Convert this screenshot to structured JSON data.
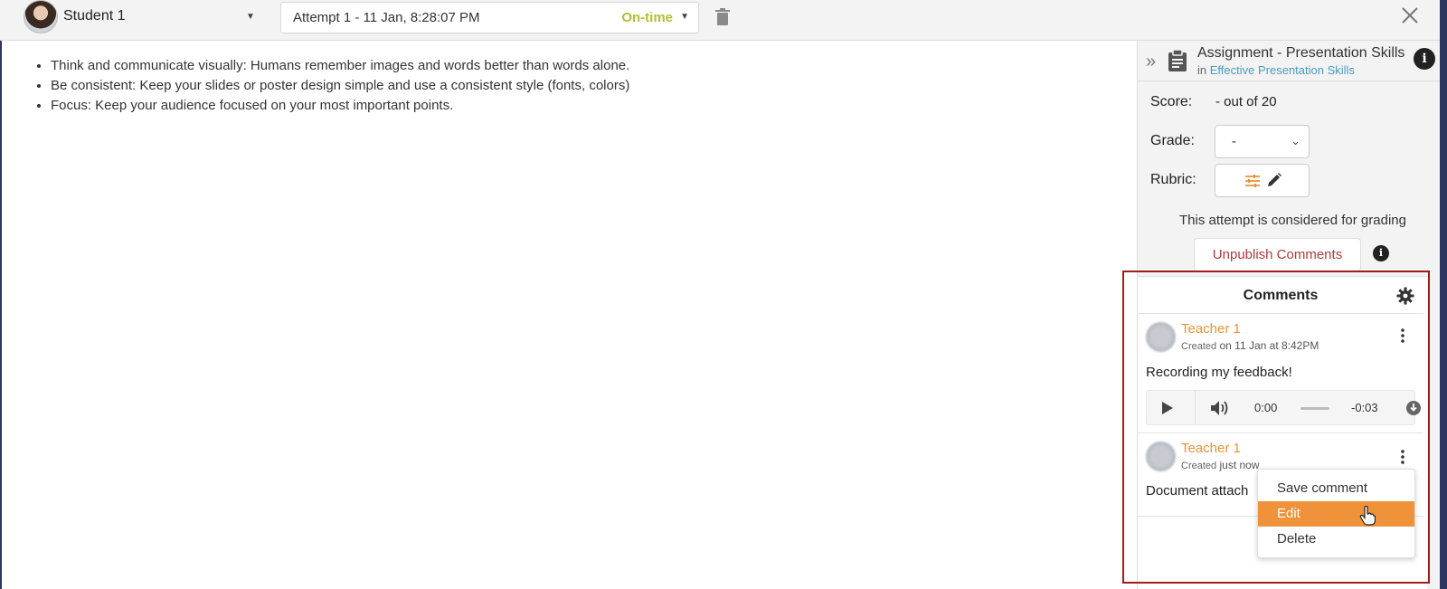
{
  "header": {
    "student_name": "Student 1",
    "attempt_label": "Attempt 1 - 11 Jan, 8:28:07 PM",
    "attempt_status": "On-time",
    "status_color": "#b0c030"
  },
  "content": {
    "bullets": [
      "Think and communicate visually: Humans remember images and words better than words alone.",
      "Be consistent: Keep your slides or poster design simple and use a consistent style (fonts, colors)",
      "Focus: Keep your audience focused on your most important points."
    ]
  },
  "sidebar": {
    "assignment_title": "Assignment - Presentation Skills",
    "in_prefix": "in",
    "course_link": "Effective Presentation Skills",
    "score_label": "Score:",
    "score_value": "- out of 20",
    "grade_label": "Grade:",
    "grade_value": "-",
    "rubric_label": "Rubric:",
    "attempt_note": "This attempt is considered for grading",
    "unpublish_label": "Unpublish Comments"
  },
  "comments": {
    "title": "Comments",
    "items": [
      {
        "author": "Teacher 1",
        "created_prefix": "Created",
        "created_when": "on 11 Jan at 8:42PM",
        "text": "Recording my feedback!",
        "audio": {
          "time": "0:00",
          "remaining": "-0:03"
        }
      },
      {
        "author": "Teacher 1",
        "created_prefix": "Created",
        "created_when": "just now",
        "text": "Document attach"
      }
    ]
  },
  "context_menu": {
    "items": [
      "Save comment",
      "Edit",
      "Delete"
    ],
    "active_index": 1,
    "active_color": "#f0923a"
  },
  "colors": {
    "accent_orange": "#e89434",
    "link_blue": "#4a9bc4",
    "unpublish_red": "#b23a3a",
    "highlight_frame": "#a01c1c"
  }
}
